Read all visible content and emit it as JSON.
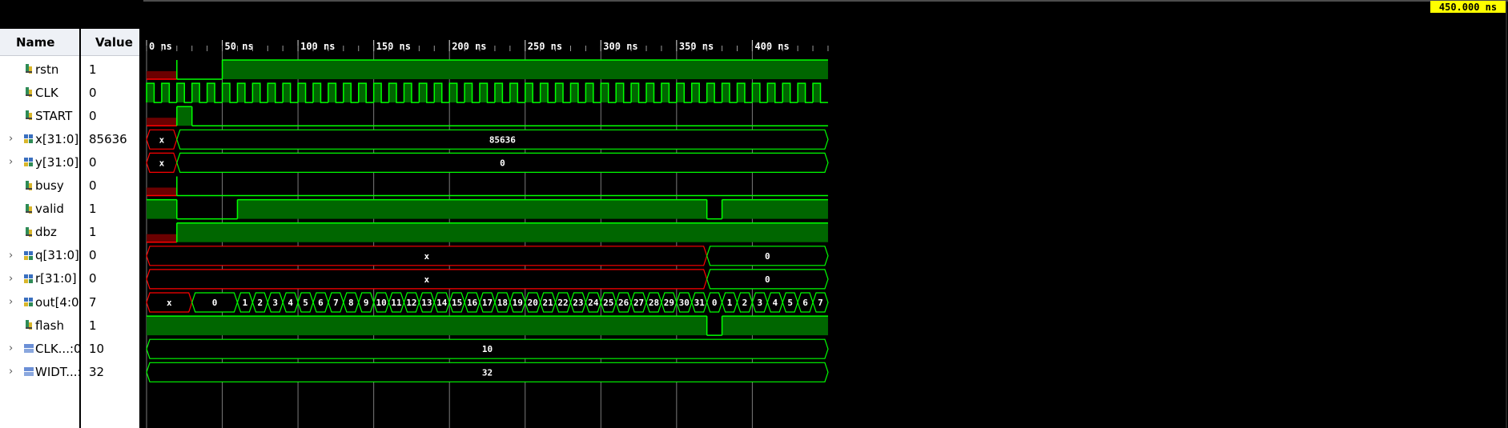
{
  "header": {
    "name_col": "Name",
    "value_col": "Value"
  },
  "cursor_time": "450.000 ns",
  "time_ticks": [
    "0 ns",
    "50 ns",
    "100 ns",
    "150 ns",
    "200 ns",
    "250 ns",
    "300 ns",
    "350 ns",
    "400 ns"
  ],
  "colors": {
    "wave": "#00ff00",
    "wave_fill": "#006600",
    "undefined": "#ff0000",
    "undefined_fill": "#6b0000",
    "grid": "#7a7a7a"
  },
  "signals": [
    {
      "name": "rstn",
      "value": "1",
      "icon": "bit-signal-icon",
      "expandable": false
    },
    {
      "name": "CLK",
      "value": "0",
      "icon": "bit-signal-icon",
      "expandable": false
    },
    {
      "name": "START",
      "value": "0",
      "icon": "bit-signal-icon",
      "expandable": false
    },
    {
      "name": "x[31:0]",
      "value": "85636",
      "icon": "bus-signal-icon",
      "expandable": true
    },
    {
      "name": "y[31:0]",
      "value": "0",
      "icon": "bus-signal-icon",
      "expandable": true
    },
    {
      "name": "busy",
      "value": "0",
      "icon": "bit-signal-icon",
      "expandable": false
    },
    {
      "name": "valid",
      "value": "1",
      "icon": "bit-signal-icon",
      "expandable": false
    },
    {
      "name": "dbz",
      "value": "1",
      "icon": "bit-signal-icon",
      "expandable": false
    },
    {
      "name": "q[31:0]",
      "value": "0",
      "icon": "bus-signal-icon",
      "expandable": true
    },
    {
      "name": "r[31:0]",
      "value": "0",
      "icon": "bus-signal-icon",
      "expandable": true
    },
    {
      "name": "out[4:0]",
      "value": "7",
      "icon": "bus-signal-icon",
      "expandable": true
    },
    {
      "name": "flash",
      "value": "1",
      "icon": "bit-signal-icon",
      "expandable": false
    },
    {
      "name": "CLK...:0]",
      "value": "10",
      "icon": "param-signal-icon",
      "expandable": true
    },
    {
      "name": "WIDT...:",
      "value": "32",
      "icon": "param-signal-icon",
      "expandable": true
    }
  ],
  "waves": [
    {
      "type": "bit",
      "segments": [
        [
          0,
          20,
          "X"
        ],
        [
          20,
          50,
          "0"
        ],
        [
          50,
          450,
          "1"
        ]
      ]
    },
    {
      "type": "clock",
      "start": 0,
      "period": 10,
      "high_first": true,
      "end": 450
    },
    {
      "type": "bit",
      "segments": [
        [
          0,
          20,
          "X"
        ],
        [
          20,
          30,
          "1"
        ],
        [
          30,
          450,
          "0"
        ]
      ]
    },
    {
      "type": "bus",
      "segments": [
        [
          0,
          20,
          "x",
          true
        ],
        [
          20,
          450,
          "85636",
          false
        ]
      ]
    },
    {
      "type": "bus",
      "segments": [
        [
          0,
          20,
          "x",
          true
        ],
        [
          20,
          450,
          "0",
          false
        ]
      ]
    },
    {
      "type": "bit",
      "segments": [
        [
          0,
          20,
          "X"
        ],
        [
          20,
          450,
          "0"
        ]
      ]
    },
    {
      "type": "bit",
      "segments": [
        [
          0,
          20,
          "1"
        ],
        [
          20,
          60,
          "0"
        ],
        [
          60,
          370,
          "1"
        ],
        [
          370,
          380,
          "0"
        ],
        [
          380,
          450,
          "1"
        ]
      ]
    },
    {
      "type": "bit",
      "segments": [
        [
          0,
          20,
          "X"
        ],
        [
          20,
          450,
          "1"
        ]
      ]
    },
    {
      "type": "bus",
      "segments": [
        [
          0,
          370,
          "x",
          true
        ],
        [
          370,
          450,
          "0",
          false
        ]
      ]
    },
    {
      "type": "bus",
      "segments": [
        [
          0,
          370,
          "x",
          true
        ],
        [
          370,
          450,
          "0",
          false
        ]
      ]
    },
    {
      "type": "bus",
      "segments": [
        [
          0,
          30,
          "x",
          true
        ],
        [
          30,
          60,
          "0",
          false
        ],
        [
          60,
          70,
          "1"
        ],
        [
          70,
          80,
          "2"
        ],
        [
          80,
          90,
          "3"
        ],
        [
          90,
          100,
          "4"
        ],
        [
          100,
          110,
          "5"
        ],
        [
          110,
          120,
          "6"
        ],
        [
          120,
          130,
          "7"
        ],
        [
          130,
          140,
          "8"
        ],
        [
          140,
          150,
          "9"
        ],
        [
          150,
          160,
          "10"
        ],
        [
          160,
          170,
          "11"
        ],
        [
          170,
          180,
          "12"
        ],
        [
          180,
          190,
          "13"
        ],
        [
          190,
          200,
          "14"
        ],
        [
          200,
          210,
          "15"
        ],
        [
          210,
          220,
          "16"
        ],
        [
          220,
          230,
          "17"
        ],
        [
          230,
          240,
          "18"
        ],
        [
          240,
          250,
          "19"
        ],
        [
          250,
          260,
          "20"
        ],
        [
          260,
          270,
          "21"
        ],
        [
          270,
          280,
          "22"
        ],
        [
          280,
          290,
          "23"
        ],
        [
          290,
          300,
          "24"
        ],
        [
          300,
          310,
          "25"
        ],
        [
          310,
          320,
          "26"
        ],
        [
          320,
          330,
          "27"
        ],
        [
          330,
          340,
          "28"
        ],
        [
          340,
          350,
          "29"
        ],
        [
          350,
          360,
          "30"
        ],
        [
          360,
          370,
          "31"
        ],
        [
          370,
          380,
          "0"
        ],
        [
          380,
          390,
          "1"
        ],
        [
          390,
          400,
          "2"
        ],
        [
          400,
          410,
          "3"
        ],
        [
          410,
          420,
          "4"
        ],
        [
          420,
          430,
          "5"
        ],
        [
          430,
          440,
          "6"
        ],
        [
          440,
          450,
          "7"
        ]
      ]
    },
    {
      "type": "bit",
      "segments": [
        [
          0,
          370,
          "1"
        ],
        [
          370,
          380,
          "0"
        ],
        [
          380,
          450,
          "1"
        ]
      ]
    },
    {
      "type": "bus",
      "segments": [
        [
          0,
          450,
          "10",
          false
        ]
      ]
    },
    {
      "type": "bus",
      "segments": [
        [
          0,
          450,
          "32",
          false
        ]
      ]
    }
  ]
}
